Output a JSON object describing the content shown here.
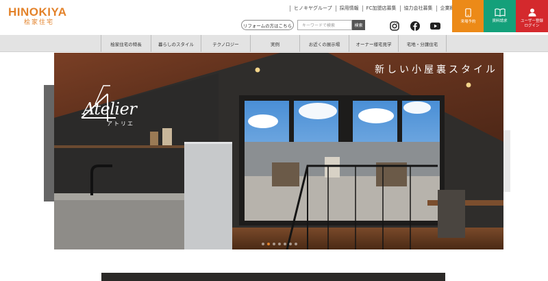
{
  "header": {
    "logo_main": "HINOKIYA",
    "logo_sub": "桧家住宅",
    "top_links": [
      "ヒノキヤグループ",
      "採用情報",
      "FC加盟店募集",
      "協力会社募集",
      "企業概要"
    ],
    "reform_label": "リフォームの方はこちら",
    "search_placeholder": "キーワードで検索",
    "search_button": "検索",
    "cta": [
      {
        "label": "来場予約",
        "icon": "phone-icon",
        "color": "#ec8a18"
      },
      {
        "label": "資料請求",
        "icon": "book-icon",
        "color": "#14a07a"
      },
      {
        "label": "ユーザー登録\nログイン",
        "icon": "user-icon",
        "color": "#d4292d"
      }
    ]
  },
  "nav": {
    "items": [
      "桧家住宅の特長",
      "暮らしのスタイル",
      "テクノロジー",
      "実例",
      "お近くの展示場",
      "オーナー様宅見学",
      "宅地・分譲住宅"
    ]
  },
  "hero": {
    "tagline": "新しい小屋裏スタイル",
    "brand": "Atelier",
    "brand_sub": "アトリエ",
    "slide_count": 7,
    "active_slide": 2
  }
}
